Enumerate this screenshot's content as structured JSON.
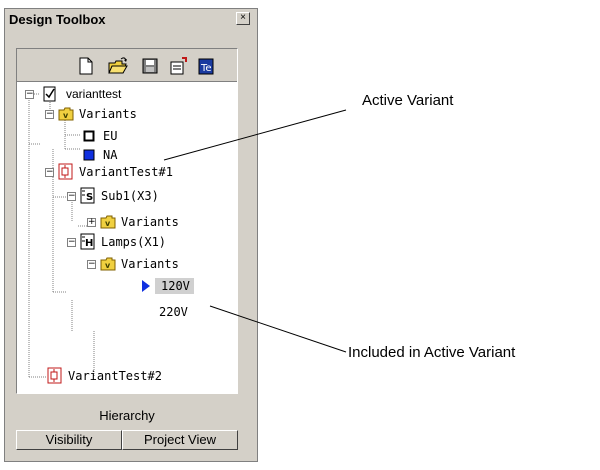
{
  "window": {
    "title": "Design Toolbox",
    "close_glyph": "×"
  },
  "toolbar": {
    "buttons": [
      {
        "icon": "new-document-icon"
      },
      {
        "icon": "open-folder-icon"
      },
      {
        "icon": "save-icon"
      },
      {
        "icon": "export-icon"
      },
      {
        "icon": "variant-manager-icon"
      }
    ]
  },
  "tree": {
    "nodes": [
      {
        "id": "root",
        "label": "varianttest",
        "icon": "checked-document-icon",
        "expander": "−"
      },
      {
        "id": "variants-top",
        "label": "Variants",
        "icon": "variant-folder-icon",
        "expander": "−"
      },
      {
        "id": "eu",
        "label": "EU",
        "icon": "inactive-variant-icon"
      },
      {
        "id": "na",
        "label": "NA",
        "icon": "active-variant-icon"
      },
      {
        "id": "vt1",
        "label": "VariantTest#1",
        "icon": "schematic-icon",
        "expander": "−"
      },
      {
        "id": "sub1",
        "label": "Sub1(X3)",
        "icon": "subcircuit-icon",
        "expander": "−"
      },
      {
        "id": "sub1-variants",
        "label": "Variants",
        "icon": "variant-folder-icon",
        "expander": "+"
      },
      {
        "id": "lamps",
        "label": "Lamps(X1)",
        "icon": "hierarchical-block-icon",
        "expander": "−"
      },
      {
        "id": "lamps-variants",
        "label": "Variants",
        "icon": "variant-folder-icon",
        "expander": "−"
      },
      {
        "id": "v120",
        "label": "120V",
        "icon": "selected-arrow-icon"
      },
      {
        "id": "v220",
        "label": "220V"
      },
      {
        "id": "vt2",
        "label": "VariantTest#2",
        "icon": "schematic-icon"
      }
    ]
  },
  "footer": {
    "section_label": "Hierarchy",
    "tabs": [
      "Visibility",
      "Project View"
    ]
  },
  "callouts": {
    "active_variant": "Active Variant",
    "included": "Included in Active Variant"
  },
  "colors": {
    "active_blue": "#1030e0",
    "folder_yellow": "#f0d040",
    "schematic_red": "#c01818",
    "selection": "#d0d0d0"
  }
}
